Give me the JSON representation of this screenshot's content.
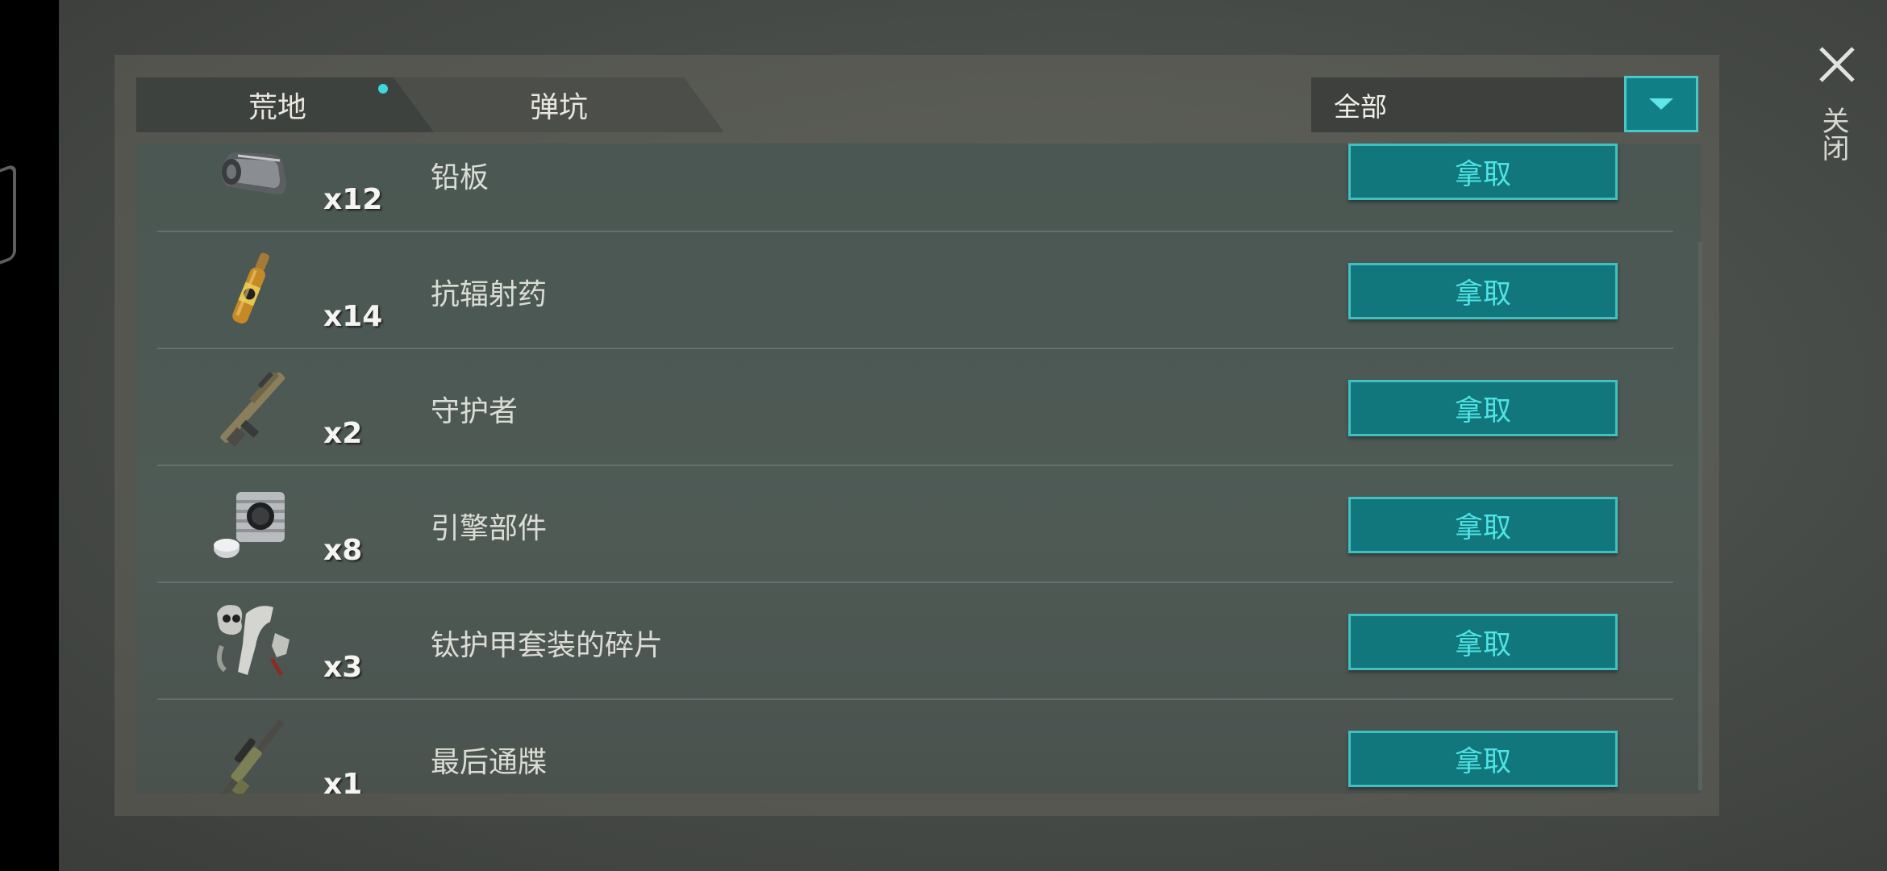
{
  "tabs": [
    {
      "label": "荒地"
    },
    {
      "label": "弹坑"
    }
  ],
  "filter": {
    "selected": "全部"
  },
  "close": {
    "label": "关闭"
  },
  "items": [
    {
      "qty": "x12",
      "name": "铅板",
      "action": "拿取",
      "icon": "lead-plate-icon"
    },
    {
      "qty": "x14",
      "name": "抗辐射药",
      "action": "拿取",
      "icon": "ampoule-icon"
    },
    {
      "qty": "x2",
      "name": "守护者",
      "action": "拿取",
      "icon": "rifle-icon"
    },
    {
      "qty": "x8",
      "name": "引擎部件",
      "action": "拿取",
      "icon": "engine-part-icon"
    },
    {
      "qty": "x3",
      "name": "钛护甲套装的碎片",
      "action": "拿取",
      "icon": "armor-fragments-icon"
    },
    {
      "qty": "x1",
      "name": "最后通牒",
      "action": "拿取",
      "icon": "sniper-rifle-icon"
    }
  ]
}
